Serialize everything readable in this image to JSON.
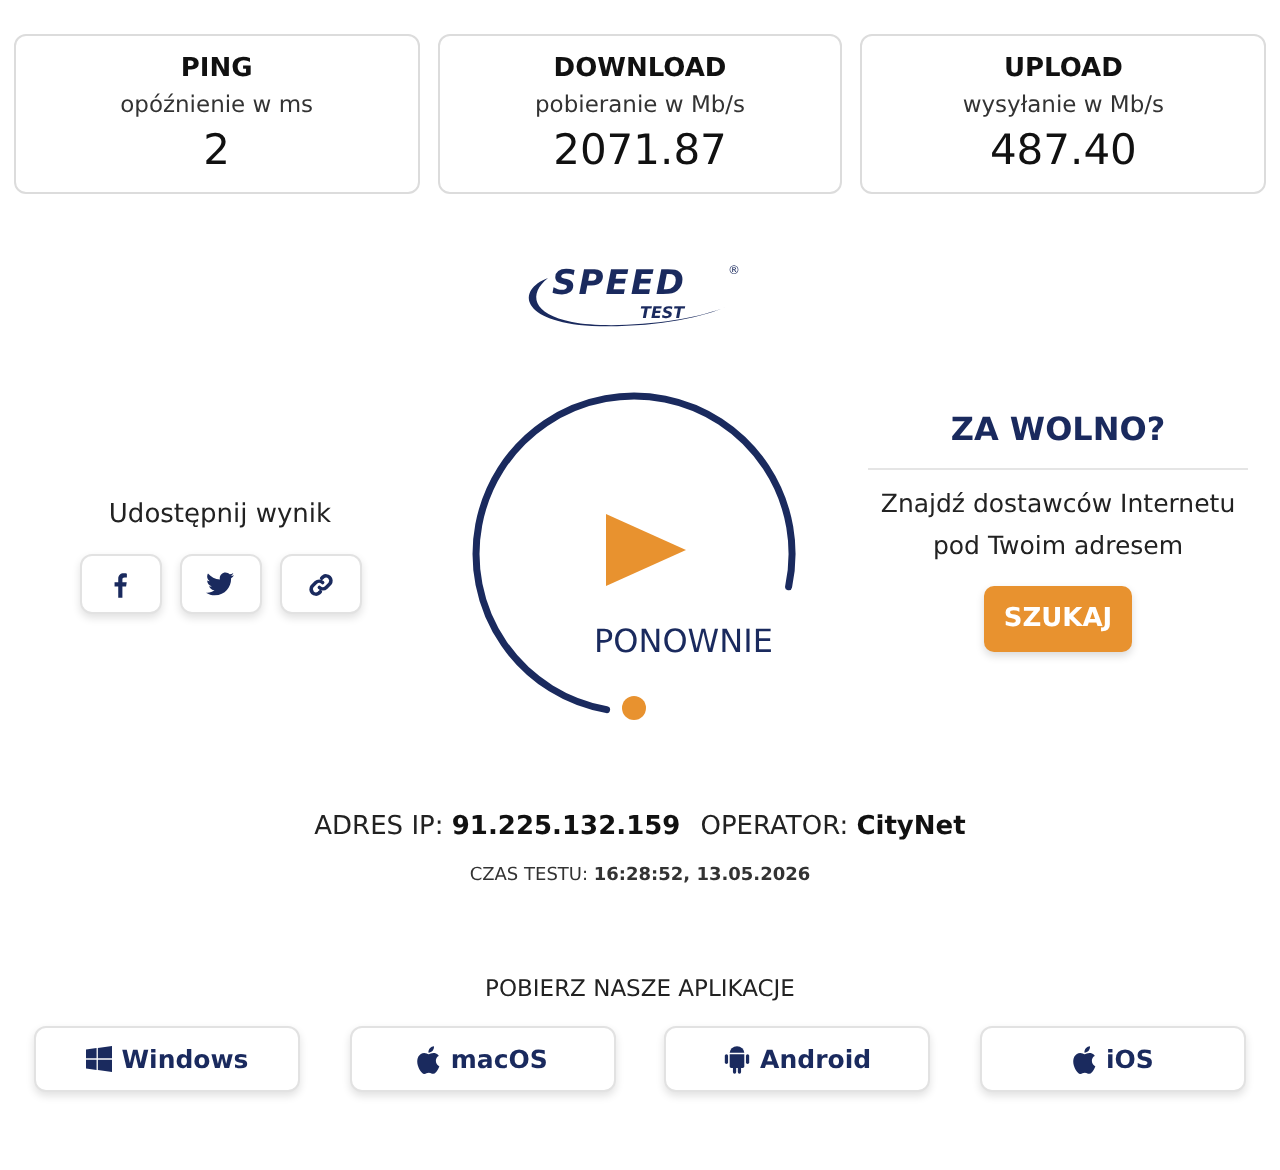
{
  "metrics": [
    {
      "title": "PING",
      "unit": "opóźnienie w ms",
      "value": "2"
    },
    {
      "title": "DOWNLOAD",
      "unit": "pobieranie w Mb/s",
      "value": "2071.87"
    },
    {
      "title": "UPLOAD",
      "unit": "wysyłanie w Mb/s",
      "value": "487.40"
    }
  ],
  "logo": {
    "word": "SPEED",
    "sub": "TEST",
    "mark": "®"
  },
  "share": {
    "label": "Udostępnij wynik",
    "buttons": [
      {
        "kind": "facebook"
      },
      {
        "kind": "twitter"
      },
      {
        "kind": "link"
      }
    ]
  },
  "gauge": {
    "button": "PONOWNIE"
  },
  "slow": {
    "title": "ZA WOLNO?",
    "text": "Znajdź dostawców Internetu pod Twoim adresem",
    "button": "SZUKAJ"
  },
  "info": {
    "ip_label": "ADRES IP:",
    "ip": "91.225.132.159",
    "operator_label": "OPERATOR:",
    "operator": "CityNet",
    "time_label": "CZAS TESTU:",
    "time": "16:28:52, 13.05.2026"
  },
  "apps": {
    "title": "POBIERZ NASZE APLIKACJE",
    "items": [
      {
        "kind": "windows",
        "label": "Windows"
      },
      {
        "kind": "apple",
        "label": "macOS"
      },
      {
        "kind": "android",
        "label": "Android"
      },
      {
        "kind": "apple",
        "label": "iOS"
      }
    ]
  }
}
